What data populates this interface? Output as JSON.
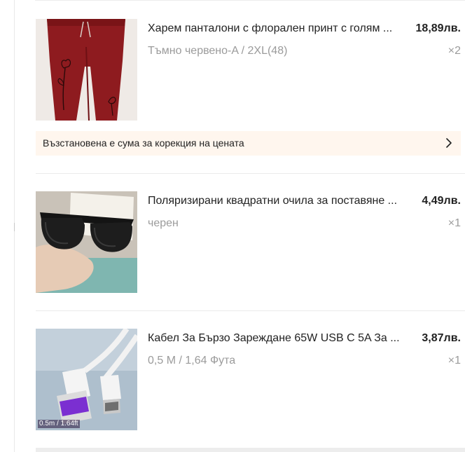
{
  "items": [
    {
      "title": "Харем панталони с флорален принт с голям ...",
      "price": "18,89лв.",
      "variant": "Тъмно червено-A / 2XL(48)",
      "quantity": "×2",
      "image_icon": "red-floral-pants-image"
    },
    {
      "title": "Поляризирани квадратни очила за поставяне ...",
      "price": "4,49лв.",
      "variant": "черен",
      "quantity": "×1",
      "image_icon": "black-sunglasses-image"
    },
    {
      "title": "Кабел За Бързо Зареждане 65W USB C 5A За ...",
      "price": "3,87лв.",
      "variant": "0,5 М / 1,64 Фута",
      "quantity": "×1",
      "image_icon": "usb-c-cable-image",
      "image_caption": "0.5m / 1.64ft"
    }
  ],
  "price_notice": {
    "text": "Възстановена е сума за корекция на цената",
    "icon": "chevron-right-icon"
  },
  "colors": {
    "notice_bg": "#fff6ee",
    "muted_text": "#9b9b9b",
    "primary_text": "#222222",
    "divider": "#ebebeb"
  }
}
